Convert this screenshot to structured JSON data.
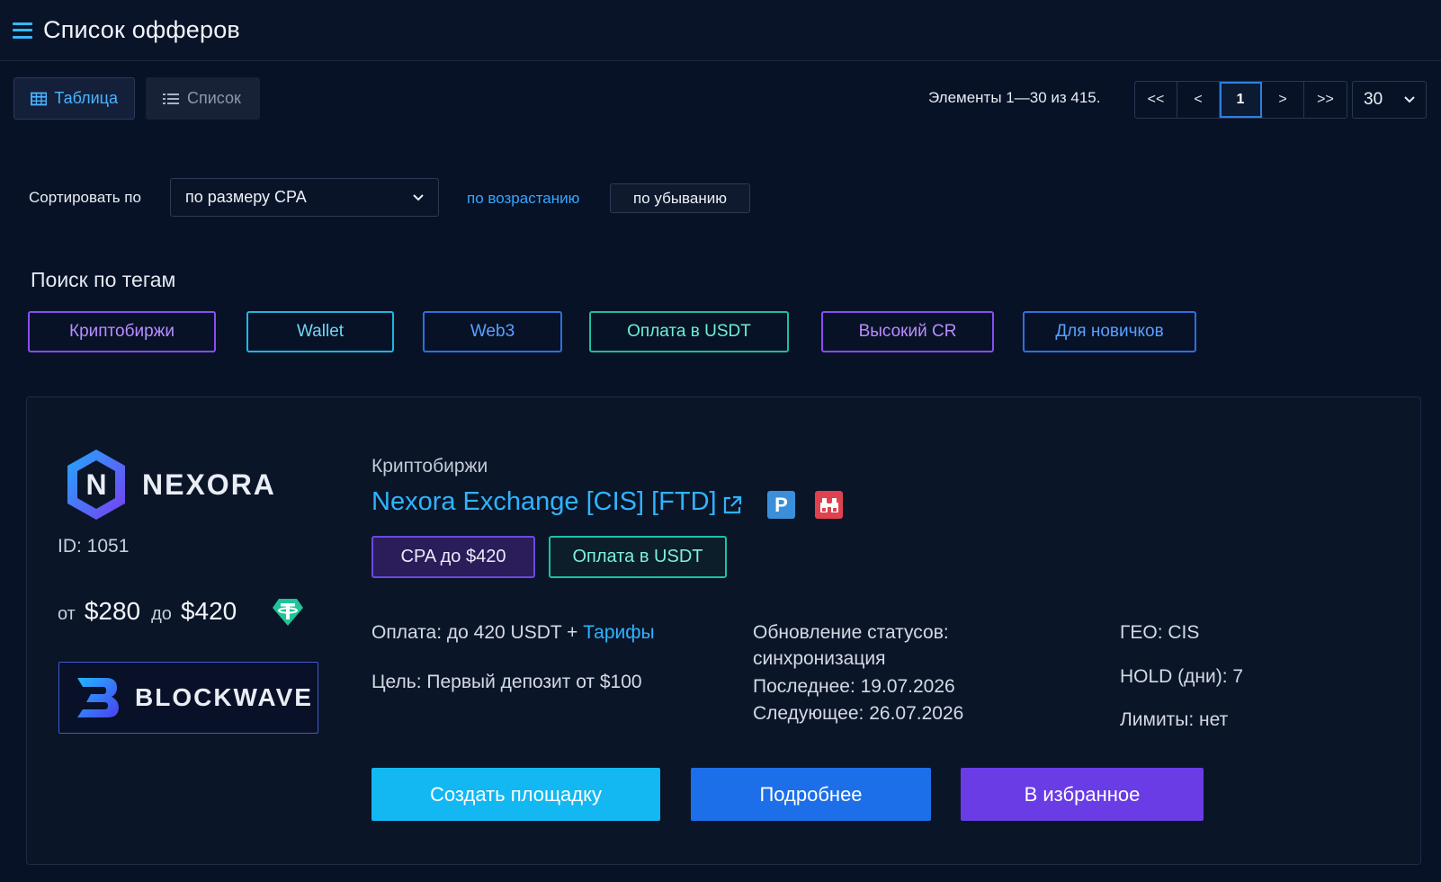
{
  "header": {
    "title": "Список офферов"
  },
  "view_toggle": {
    "table_label": "Таблица",
    "list_label": "Список"
  },
  "pagination": {
    "info": "Элементы 1—30 из 415.",
    "first": "<<",
    "prev": "<",
    "current": "1",
    "next": ">",
    "last": ">>",
    "per_page": "30"
  },
  "sort": {
    "label": "Сортировать по",
    "selected": "по размеру CPA",
    "asc": "по возрастанию",
    "desc": "по убыванию"
  },
  "tags": {
    "title": "Поиск по тегам",
    "items": [
      {
        "label": "Криптобиржи",
        "color": "#8a4df2",
        "text_color": "#b98cff"
      },
      {
        "label": "Wallet",
        "color": "#1fb7e0",
        "text_color": "#6fd7f5"
      },
      {
        "label": "Web3",
        "color": "#2f6fe0",
        "text_color": "#5aa0ff"
      },
      {
        "label": "Оплата в USDT",
        "color": "#1bbf9f",
        "text_color": "#6ff0d6"
      },
      {
        "label": "Высокий CR",
        "color": "#8a4df2",
        "text_color": "#b98cff"
      },
      {
        "label": "Для новичков",
        "color": "#2f6fe0",
        "text_color": "#5aa0ff"
      }
    ]
  },
  "offer": {
    "brand": "NEXORA",
    "id_text": "ID: 1051",
    "price": {
      "from_label": "от",
      "from": "$280",
      "to_label": "до",
      "to": "$420"
    },
    "partner": "BLOCKWAVE",
    "category": "Криптобиржи",
    "title": "Nexora Exchange [CIS] [FTD]",
    "badge_cpa": "CPA до $420",
    "badge_payment": "Оплата в USDT",
    "payment_text": "Оплата: до 420 USDT + ",
    "tariffs_link": "Тарифы",
    "goal_text": "Цель: Первый депозит от $100",
    "status_update_label": "Обновление статусов:",
    "status_update_value": "синхронизация",
    "last_update": "Последнее: 19.07.2026",
    "next_update": "Следующее: 26.07.2026",
    "geo": "ГЕО: CIS",
    "hold": "HOLD (дни): 7",
    "limits": "Лимиты: нет",
    "buttons": {
      "create": "Создать площадку",
      "details": "Подробнее",
      "favorite": "В избранное"
    }
  },
  "colors": {
    "background": "#071227",
    "accent": "#2fb4ff",
    "create_button": "#13b8f2",
    "details_button": "#1c6fe8",
    "favorite_button": "#6a3ce6"
  }
}
